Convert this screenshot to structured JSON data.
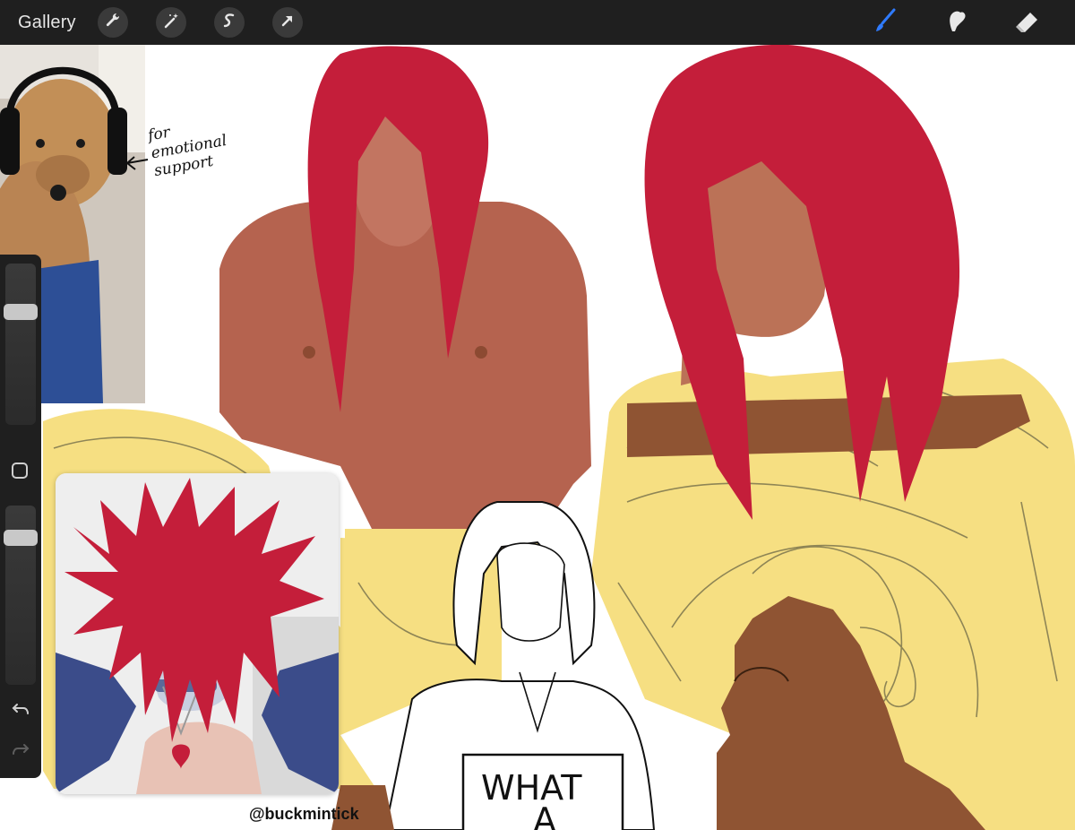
{
  "app": {
    "gallery_label": "Gallery",
    "left_tools": [
      {
        "icon": "wrench-icon",
        "name": "actions"
      },
      {
        "icon": "magic-wand-icon",
        "name": "adjustments"
      },
      {
        "icon": "selection-icon",
        "name": "selection"
      },
      {
        "icon": "transform-arrow-icon",
        "name": "transform"
      }
    ],
    "right_tools": [
      {
        "icon": "brush-icon",
        "name": "paint",
        "active": true
      },
      {
        "icon": "smudge-icon",
        "name": "smudge"
      },
      {
        "icon": "eraser-icon",
        "name": "erase"
      }
    ],
    "accent_color": "#1f6bff"
  },
  "sidebar": {
    "size_slider_level": 0.72,
    "opacity_slider_level": 0.85
  },
  "canvas": {
    "annotation_text": "for emotional support",
    "sign_text_line1": "WHAT",
    "sign_text_line2": "A",
    "watermark": "@buckmintick",
    "colors": {
      "hair_red": "#c41e3a",
      "skin": "#b5634f",
      "flat_skin": "#8f5433",
      "flat_yellow": "#f6df82"
    }
  }
}
